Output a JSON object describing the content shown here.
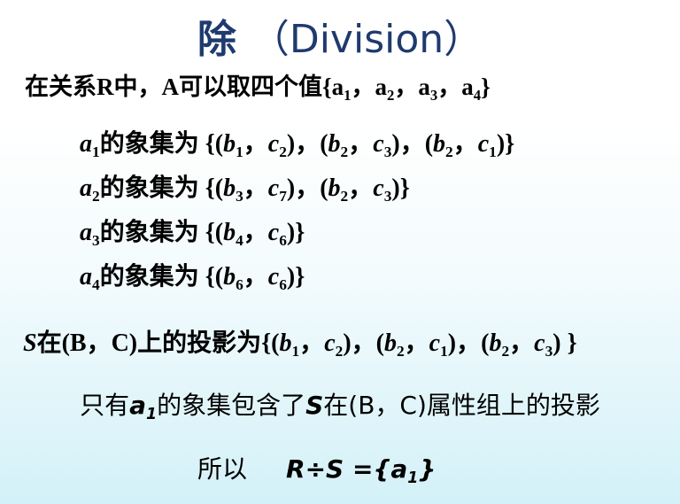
{
  "title": {
    "cn": "除",
    "en": "（Division）"
  },
  "line1": {
    "text": "在关系R中，A可以取四个值",
    "a1": "a",
    "a2": "a",
    "a3": "a",
    "a4": "a"
  },
  "image_label": "的象集为",
  "projection": {
    "prefix": "S",
    "text": "在(B，C)上的投影为"
  },
  "only_line": {
    "text1": "只有",
    "a": "a",
    "sub": "1",
    "text2": "的象集包含了",
    "s": "S",
    "text3": "在(B，C)属性组上的投影"
  },
  "conclusion": {
    "label": "所以",
    "expr_left": "R÷S =",
    "set_open": "{a",
    "sub": "1",
    "set_close": "}"
  }
}
